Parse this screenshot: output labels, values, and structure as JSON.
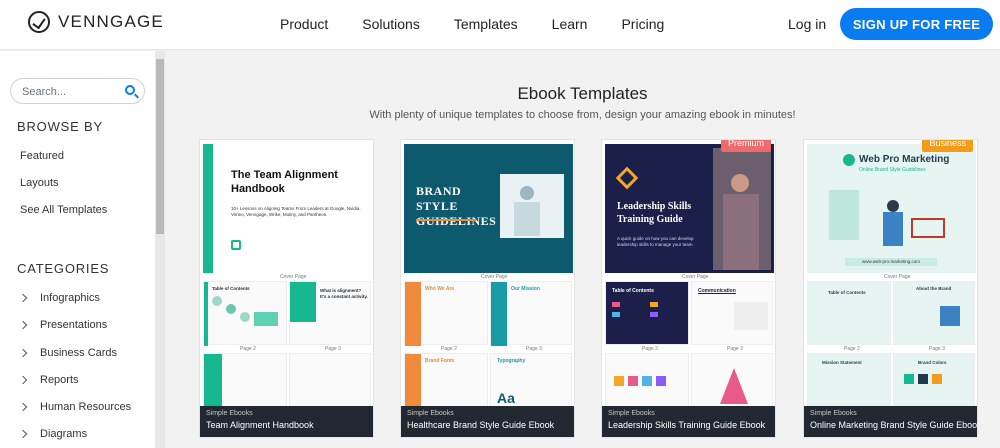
{
  "header": {
    "brand": "VENNGAGE",
    "nav": [
      "Product",
      "Solutions",
      "Templates",
      "Learn",
      "Pricing"
    ],
    "login": "Log in",
    "signup": "SIGN UP FOR FREE"
  },
  "sidebar": {
    "search_placeholder": "Search...",
    "browse_title": "BROWSE BY",
    "browse_items": [
      "Featured",
      "Layouts",
      "See All Templates"
    ],
    "categories_title": "CATEGORIES",
    "categories": [
      "Infographics",
      "Presentations",
      "Business Cards",
      "Reports",
      "Human Resources",
      "Diagrams"
    ]
  },
  "main": {
    "title": "Ebook Templates",
    "subtitle": "With plenty of unique templates to choose from, design your amazing ebook in minutes!",
    "cards": [
      {
        "category": "Simple Ebooks",
        "title": "Team Alignment Handbook",
        "badge": "",
        "cover_title": "The Team Alignment Handbook",
        "cover_text": "10+ Lessons on Aligning Teams From Leaders at Google, Nvidia, Vimeo, Venngage, Wrike, Mutiny, and Pantheon.",
        "cover_label": "Cover Page",
        "page2_label": "Page 2",
        "page3_label": "Page 3",
        "toc": "Table of Contents",
        "aside": "What is alignment? It's a constant activity."
      },
      {
        "category": "Simple Ebooks",
        "title": "Healthcare Brand Style Guide Ebook",
        "badge": "",
        "cover_title": "BRAND STYLE GUIDELINES",
        "cover_label": "Cover Page",
        "page2_label": "Page 2",
        "page3_label": "Page 3",
        "p2_heading": "Who We Are",
        "p3_heading": "Our Mission",
        "p4_heading": "Brand Fonts",
        "p5_heading": "Typography",
        "p5_sample": "Aa"
      },
      {
        "category": "Simple Ebooks",
        "title": "Leadership Skills Training Guide Ebook",
        "badge": "Premium",
        "cover_title": "Leadership Skills Training Guide",
        "cover_text": "A quick guide on how you can develop leadership skills to manage your team",
        "cover_label": "Cover Page",
        "page2_label": "Page 2",
        "page3_label": "Page 3",
        "p2_heading": "Table of Contents",
        "p3_heading": "Communication"
      },
      {
        "category": "Simple Ebooks",
        "title": "Online Marketing Brand Style Guide Ebook",
        "badge": "Business",
        "cover_title": "Web Pro Marketing",
        "cover_subtitle": "Online Brand Style Guidelines",
        "cover_url": "www.web-pro-marketing.com",
        "cover_label": "Cover Page",
        "page2_label": "Page 2",
        "page3_label": "Page 3",
        "p2_heading": "Table of Contents",
        "p3_heading": "About the Brand",
        "p4_heading": "Mission Statement",
        "p5_heading": "Brand Colors"
      }
    ]
  },
  "colors": {
    "accent": "#0a7cf2",
    "premium": "#ef6b6b",
    "business": "#f39c1b",
    "teal": "#17b890"
  }
}
